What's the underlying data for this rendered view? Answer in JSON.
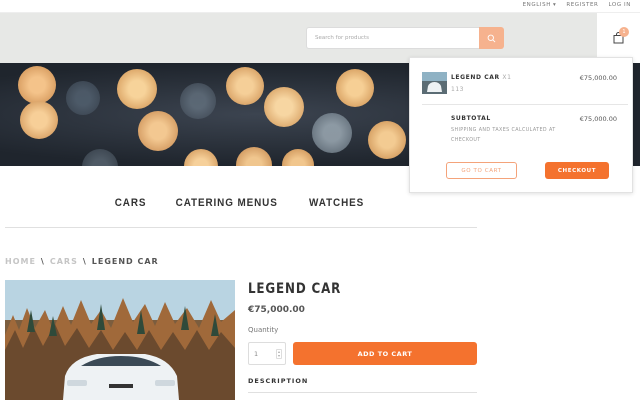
{
  "topbar": {
    "language": "ENGLISH",
    "register": "REGISTER",
    "login": "LOG IN"
  },
  "search": {
    "placeholder": "Search for products",
    "icon": "search-icon"
  },
  "cart": {
    "icon": "shopping-bag-icon",
    "badge": "1",
    "item": {
      "name": "LEGEND CAR",
      "qty": "X1",
      "code": "113",
      "price": "€75,000.00"
    },
    "subtotal_label": "SUBTOTAL",
    "subtotal_value": "€75,000.00",
    "note": "SHIPPING AND TAXES CALCULATED AT CHECKOUT",
    "goto_label": "GO TO CART",
    "checkout_label": "CHECKOUT"
  },
  "nav": {
    "items": [
      "CARS",
      "CATERING MENUS",
      "WATCHES"
    ]
  },
  "breadcrumb": {
    "home": "HOME",
    "sep1": "\\",
    "category": "CARS",
    "sep2": "\\",
    "current": "LEGEND CAR"
  },
  "product": {
    "title": "LEGEND CAR",
    "price": "€75,000.00",
    "quantity_label": "Quantity",
    "quantity_value": "1",
    "add_to_cart": "ADD TO CART",
    "description_label": "DESCRIPTION"
  },
  "colors": {
    "accent": "#f4722e",
    "accent_light": "#f6b28e",
    "header_bg": "#e7e8e6"
  }
}
